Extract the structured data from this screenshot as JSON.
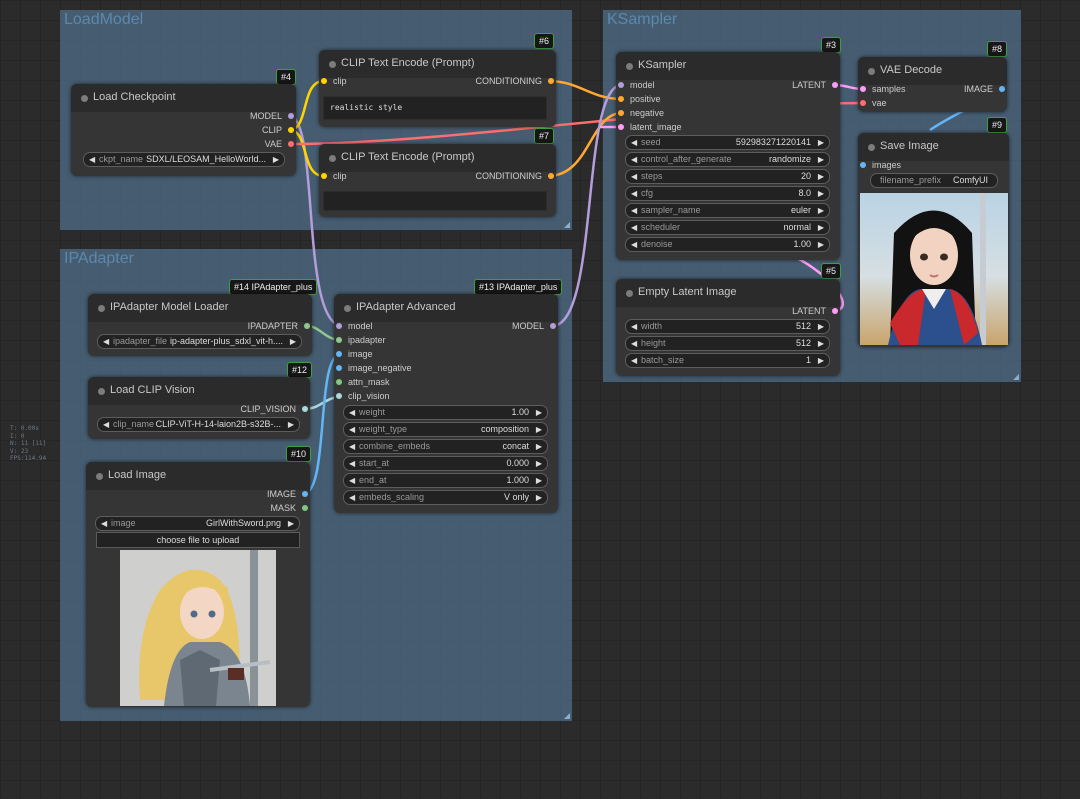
{
  "groups": {
    "load_model": "LoadModel",
    "ipadapter": "IPAdapter",
    "ksampler": "KSampler"
  },
  "colors": {
    "model": "#b39ddb",
    "clip": "#ffd500",
    "vae": "#ff6e6e",
    "conditioning": "#ffa931",
    "latent": "#ff9cf9",
    "image": "#64b5f6",
    "ipadapter": "#8fc78f",
    "clip_vision": "#a8dadc",
    "mask": "#81c784"
  },
  "stats": [
    "T: 0.00s",
    "I: 0",
    "N: 11 [11]",
    "V: 23",
    "FPS:114.94"
  ],
  "nodes": {
    "load_checkpoint": {
      "badge": "#4",
      "title": "Load Checkpoint",
      "outputs": [
        "MODEL",
        "CLIP",
        "VAE"
      ],
      "ckpt_name_label": "ckpt_name",
      "ckpt_name_value": "SDXL/LEOSAM_HelloWorld..."
    },
    "clip_text_encode_pos": {
      "badge": "#6",
      "title": "CLIP Text Encode (Prompt)",
      "input": "clip",
      "output": "CONDITIONING",
      "text": "realistic style"
    },
    "clip_text_encode_neg": {
      "badge": "#7",
      "title": "CLIP Text Encode (Prompt)",
      "input": "clip",
      "output": "CONDITIONING",
      "text": ""
    },
    "ksampler": {
      "badge": "#3",
      "title": "KSampler",
      "inputs": [
        "model",
        "positive",
        "negative",
        "latent_image"
      ],
      "output": "LATENT",
      "widgets": [
        {
          "name": "seed",
          "value": "592983271220141"
        },
        {
          "name": "control_after_generate",
          "value": "randomize"
        },
        {
          "name": "steps",
          "value": "20"
        },
        {
          "name": "cfg",
          "value": "8.0"
        },
        {
          "name": "sampler_name",
          "value": "euler"
        },
        {
          "name": "scheduler",
          "value": "normal"
        },
        {
          "name": "denoise",
          "value": "1.00"
        }
      ]
    },
    "vae_decode": {
      "badge": "#8",
      "title": "VAE Decode",
      "inputs": [
        "samples",
        "vae"
      ],
      "output": "IMAGE"
    },
    "save_image": {
      "badge": "#9",
      "title": "Save Image",
      "input": "images",
      "filename_prefix_label": "filename_prefix",
      "filename_prefix_value": "ComfyUI"
    },
    "empty_latent": {
      "badge": "#5",
      "title": "Empty Latent Image",
      "output": "LATENT",
      "widgets": [
        {
          "name": "width",
          "value": "512"
        },
        {
          "name": "height",
          "value": "512"
        },
        {
          "name": "batch_size",
          "value": "1"
        }
      ]
    },
    "ipadapter_loader": {
      "badge": "#14 IPAdapter_plus",
      "title": "IPAdapter Model Loader",
      "output": "IPADAPTER",
      "file_label": "ipadapter_file",
      "file_value": "ip-adapter-plus_sdxl_vit-h...."
    },
    "clip_vision": {
      "badge": "#12",
      "title": "Load CLIP Vision",
      "output": "CLIP_VISION",
      "clip_label": "clip_name",
      "clip_value": "CLIP-ViT-H-14-laion2B-s32B-..."
    },
    "load_image": {
      "badge": "#10",
      "title": "Load Image",
      "outputs": [
        "IMAGE",
        "MASK"
      ],
      "image_label": "image",
      "image_value": "GirlWithSword.png",
      "upload_label": "choose file to upload"
    },
    "ipadapter_advanced": {
      "badge": "#13 IPAdapter_plus",
      "title": "IPAdapter Advanced",
      "inputs": [
        "model",
        "ipadapter",
        "image",
        "image_negative",
        "attn_mask",
        "clip_vision"
      ],
      "output": "MODEL",
      "widgets": [
        {
          "name": "weight",
          "value": "1.00"
        },
        {
          "name": "weight_type",
          "value": "composition"
        },
        {
          "name": "combine_embeds",
          "value": "concat"
        },
        {
          "name": "start_at",
          "value": "0.000"
        },
        {
          "name": "end_at",
          "value": "1.000"
        },
        {
          "name": "embeds_scaling",
          "value": "V only"
        }
      ]
    }
  }
}
